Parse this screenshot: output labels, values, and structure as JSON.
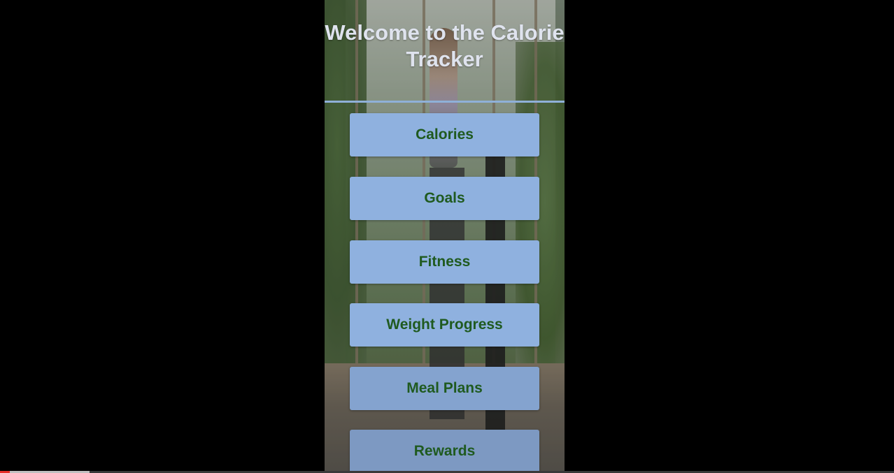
{
  "app": {
    "title": "Welcome to the Calorie Tracker"
  },
  "menu": {
    "items": [
      {
        "label": "Calories"
      },
      {
        "label": "Goals"
      },
      {
        "label": "Fitness"
      },
      {
        "label": "Weight Progress"
      },
      {
        "label": "Meal Plans"
      },
      {
        "label": "Rewards"
      }
    ]
  },
  "video": {
    "progress_fraction": 0.1
  },
  "colors": {
    "background": "#000000",
    "button_fill": "#8fb1df",
    "button_text": "#1f5a1f",
    "title_text": "#dfe3ee",
    "divider": "#8fb0d8",
    "progress_played": "#e52d27",
    "progress_buffered": "#c0c0c0"
  }
}
